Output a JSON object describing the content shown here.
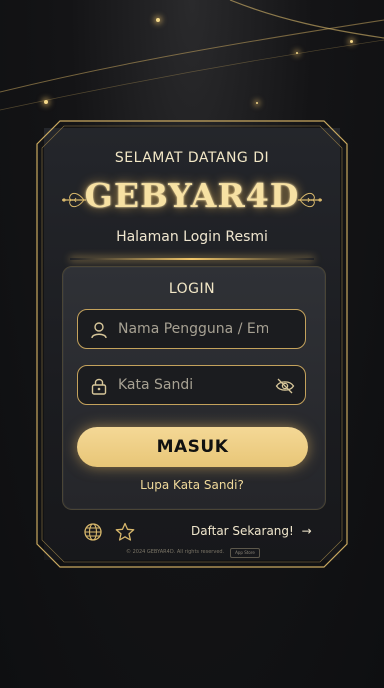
{
  "header": {
    "welcome": "SELAMAT DATANG DI",
    "brand": "GEBYAR4D",
    "subtitle": "Halaman Login Resmi"
  },
  "login": {
    "title": "LOGIN",
    "username_placeholder": "Nama Pengguna / Email",
    "password_placeholder": "Kata Sandi",
    "submit_label": "MASUK",
    "forgot_label": "Lupa Kata Sandi?"
  },
  "footer": {
    "register_label": "Daftar Sekarang!",
    "register_arrow": "→",
    "copyright": "© 2024 GEBYAR4D. All rights reserved.",
    "store_badge": "App Store"
  },
  "icons": {
    "username": "user-icon",
    "password": "lock-icon",
    "toggle": "eye-off-icon",
    "language": "globe-icon",
    "favorite": "star-icon",
    "arrow": "arrow-right-icon"
  },
  "colors": {
    "accent": "#e8c677",
    "gold_border": "#c4a25c",
    "background": "#141416"
  }
}
